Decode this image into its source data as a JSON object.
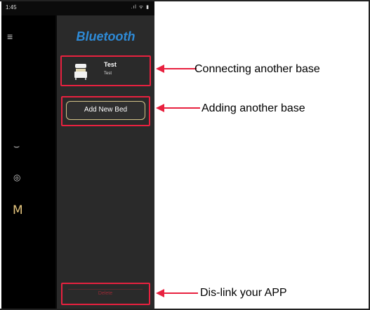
{
  "status_bar": {
    "time": "1:45",
    "icons": ".ıl ᯤ ▮"
  },
  "rail": {
    "menu_icon": "≡",
    "icon_mid": "⌣",
    "icon_eye": "◎",
    "icon_m": "M"
  },
  "drawer": {
    "title": "Bluetooth",
    "bed": {
      "name": "Test",
      "subtitle": "Test"
    },
    "add_button": "Add New Bed",
    "delete_button": "Delete"
  },
  "annotations": {
    "connect": "Connecting another base",
    "add": "Adding another base",
    "unlink": "Dis-link your APP"
  },
  "colors": {
    "accent_blue": "#2e8ad6",
    "highlight_red": "#e8213f",
    "gold": "#d6c58a"
  }
}
